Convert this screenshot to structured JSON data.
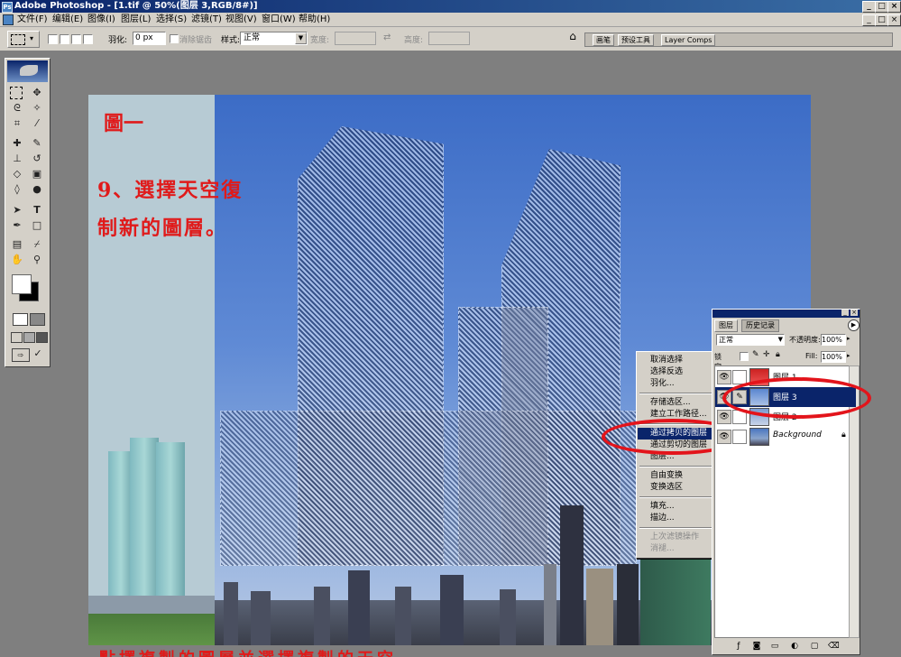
{
  "window": {
    "title": "Adobe Photoshop - [1.tif @ 50%(图层 3,RGB/8#)]",
    "min_glyph": "_",
    "max_glyph": "□",
    "close_glyph": "×"
  },
  "menu": {
    "items": [
      "文件(F)",
      "编辑(E)",
      "图像(I)",
      "图层(L)",
      "选择(S)",
      "滤镜(T)",
      "视图(V)",
      "窗口(W)",
      "帮助(H)"
    ]
  },
  "options": {
    "feather_label": "羽化:",
    "feather_value": "0 px",
    "antialias_label": "消除锯齿",
    "style_label": "样式:",
    "style_value": "正常",
    "width_label": "宽度:",
    "height_label": "高度:",
    "palette_tabs": [
      "画笔",
      "预设工具",
      "Layer Comps"
    ]
  },
  "document": {
    "figure_label": "圖一",
    "step_line1": "9、選擇天空復",
    "step_line2": "制新的圖層。",
    "bottom_text": "點擇複製的圖層並選擇複製的天空..."
  },
  "context_menu": {
    "items": [
      {
        "label": "取消选择",
        "disabled": false,
        "selected": false
      },
      {
        "label": "选择反选",
        "disabled": false,
        "selected": false
      },
      {
        "label": "羽化...",
        "disabled": false,
        "selected": false
      },
      {
        "label": "存储选区...",
        "disabled": false,
        "selected": false
      },
      {
        "label": "建立工作路径...",
        "disabled": false,
        "selected": false
      },
      {
        "label": "通过拷贝的图层",
        "disabled": false,
        "selected": true
      },
      {
        "label": "通过剪切的图层",
        "disabled": false,
        "selected": false
      },
      {
        "label": "图层...",
        "disabled": false,
        "selected": false
      },
      {
        "label": "自由变换",
        "disabled": false,
        "selected": false
      },
      {
        "label": "变换选区",
        "disabled": false,
        "selected": false
      },
      {
        "label": "填充...",
        "disabled": false,
        "selected": false
      },
      {
        "label": "描边...",
        "disabled": false,
        "selected": false
      },
      {
        "label": "上次滤镜操作",
        "disabled": true,
        "selected": false
      },
      {
        "label": "消褪...",
        "disabled": true,
        "selected": false
      }
    ]
  },
  "layers_panel": {
    "tabs": [
      "图层",
      "历史记录"
    ],
    "blend_mode": "正常",
    "opacity_label": "不透明度:",
    "opacity_value": "100%",
    "lock_label": "锁定:",
    "fill_label": "Fill:",
    "fill_value": "100%",
    "layers": [
      {
        "name": "图层 1",
        "selected": false,
        "visible": true
      },
      {
        "name": "图层 3",
        "selected": true,
        "visible": true
      },
      {
        "name": "图层 2",
        "selected": false,
        "visible": true
      },
      {
        "name": "Background",
        "selected": false,
        "visible": true,
        "locked": true
      }
    ]
  },
  "colors": {
    "annotation_red": "#e3141b",
    "selection_blue": "#0a246a",
    "ui_gray": "#d4d0c8"
  }
}
